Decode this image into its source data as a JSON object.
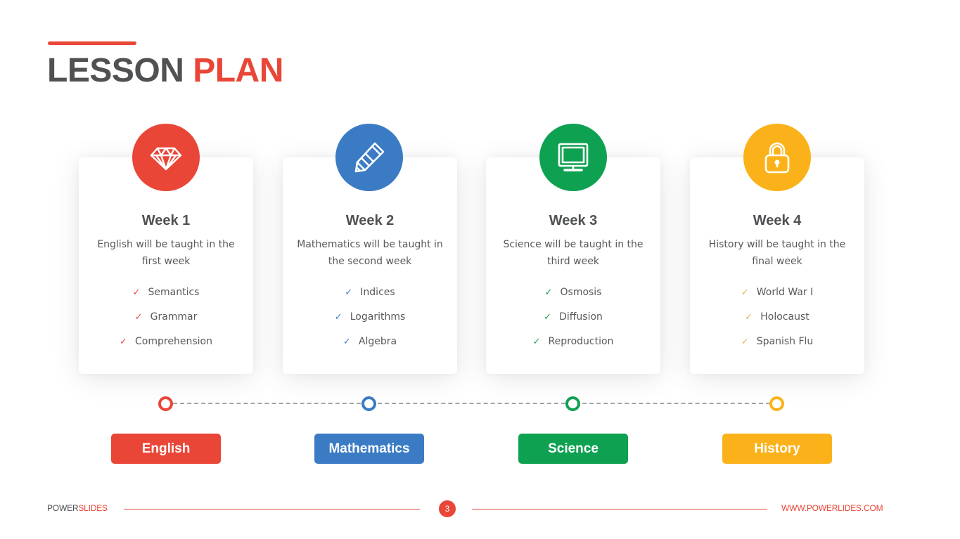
{
  "title": {
    "part1": "LESSON",
    "part2": "PLAN"
  },
  "colors": {
    "red": "#e94638",
    "blue": "#3a7bc4",
    "green": "#0fa152",
    "yellow": "#fbb21a",
    "dark_text": "#4f5153"
  },
  "weeks": [
    {
      "heading": "Week 1",
      "description": "English will be taught in the first week",
      "icon": "diamond-icon",
      "color": "#e94638",
      "topics": [
        "Semantics",
        "Grammar",
        "Comprehension"
      ],
      "subject": "English"
    },
    {
      "heading": "Week 2",
      "description": "Mathematics will be taught in the second week",
      "icon": "pencil-icon",
      "color": "#3a7bc4",
      "topics": [
        "Indices",
        "Logarithms",
        "Algebra"
      ],
      "subject": "Mathematics"
    },
    {
      "heading": "Week 3",
      "description": "Science will be taught in the third week",
      "icon": "monitor-icon",
      "color": "#0fa152",
      "topics": [
        "Osmosis",
        "Diffusion",
        "Reproduction"
      ],
      "subject": "Science"
    },
    {
      "heading": "Week 4",
      "description": "History will be taught in the final week",
      "icon": "lock-icon",
      "color": "#fbb21a",
      "topics": [
        "World War I",
        "Holocaust",
        "Spanish Flu"
      ],
      "subject": "History"
    }
  ],
  "check_glyph": "✓",
  "footer": {
    "brand_part1": "POWER",
    "brand_part2": "SLIDES",
    "page_number": "3",
    "url": "WWW.POWERLIDES.COM"
  }
}
